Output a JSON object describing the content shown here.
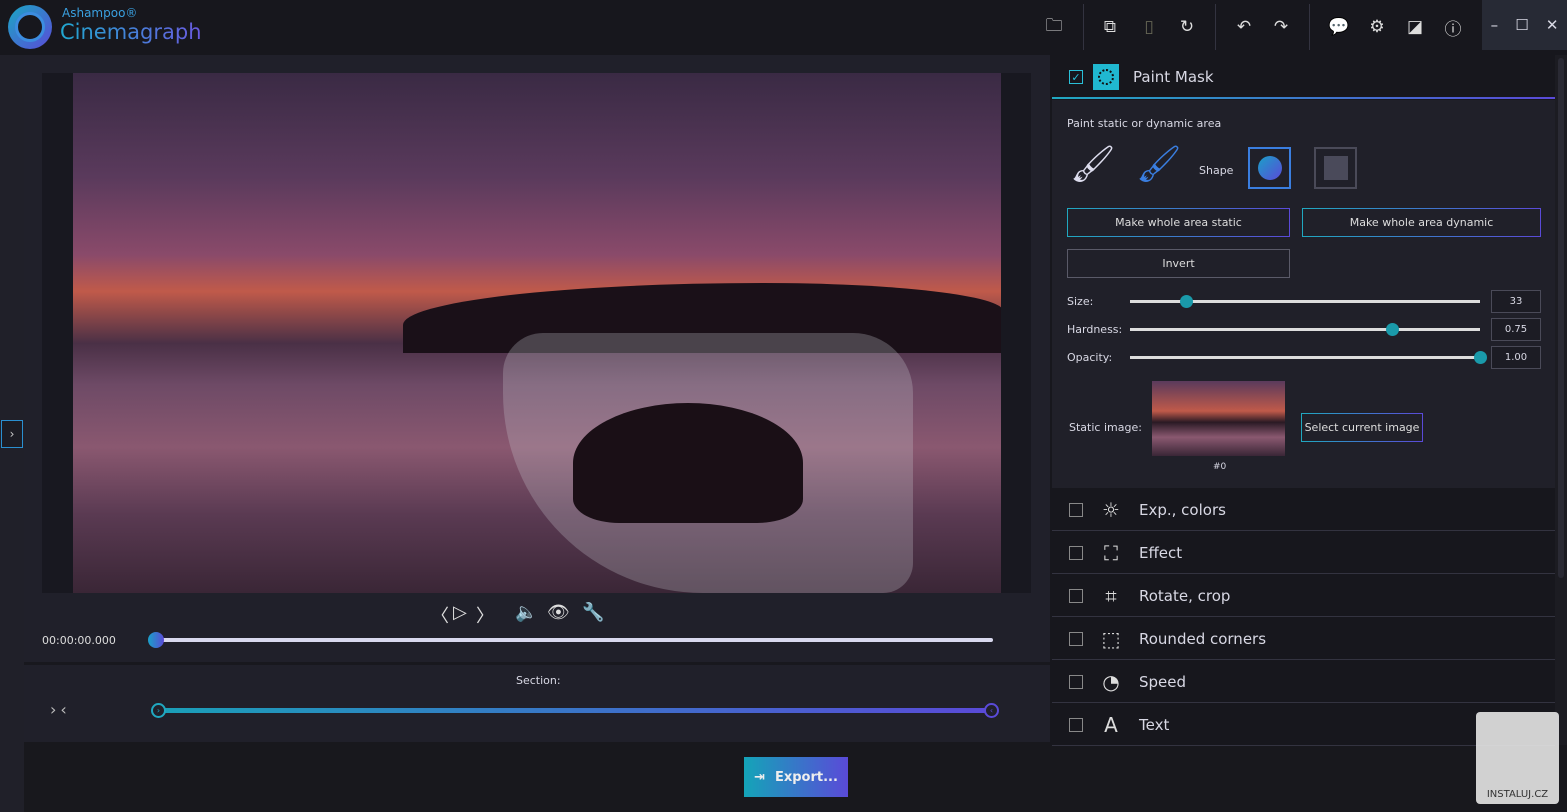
{
  "app": {
    "brand_top": "Ashampoo®",
    "brand_name": "Cinemagraph"
  },
  "toolbar": {
    "icons": [
      "folder-icon",
      "copy-icon",
      "paste-icon",
      "reset-icon",
      "undo-icon",
      "redo-icon",
      "feedback-icon",
      "gear-icon",
      "compare-icon",
      "info-icon"
    ]
  },
  "window": {
    "minimize": "–",
    "maximize": "☐",
    "close": "✕"
  },
  "player": {
    "time": "00:00:00.000",
    "position": 0
  },
  "section": {
    "label": "Section:",
    "start": 0,
    "end": 1
  },
  "export": {
    "label": "Export..."
  },
  "paint_mask": {
    "title": "Paint Mask",
    "checked": true,
    "subtitle": "Paint static or dynamic area",
    "shape_label": "Shape",
    "make_static": "Make whole area static",
    "make_dynamic": "Make whole area dynamic",
    "invert": "Invert",
    "size_label": "Size:",
    "size": "33",
    "size_frac": 0.16,
    "hardness_label": "Hardness:",
    "hardness": "0.75",
    "hardness_frac": 0.75,
    "opacity_label": "Opacity:",
    "opacity": "1.00",
    "opacity_frac": 1.0,
    "static_image_label": "Static image:",
    "frame": "#0",
    "select_current": "Select current image"
  },
  "sections": [
    {
      "label": "Exp., colors",
      "icon": "☼"
    },
    {
      "label": "Effect",
      "icon": "⛶"
    },
    {
      "label": "Rotate, crop",
      "icon": "⌗"
    },
    {
      "label": "Rounded corners",
      "icon": "⬚"
    },
    {
      "label": "Speed",
      "icon": "◔"
    },
    {
      "label": "Text",
      "icon": "A"
    }
  ],
  "watermark": {
    "text": "INSTALUJ.CZ"
  },
  "colors": {
    "accent1": "#20a8c0",
    "accent2": "#5a4ad8"
  }
}
